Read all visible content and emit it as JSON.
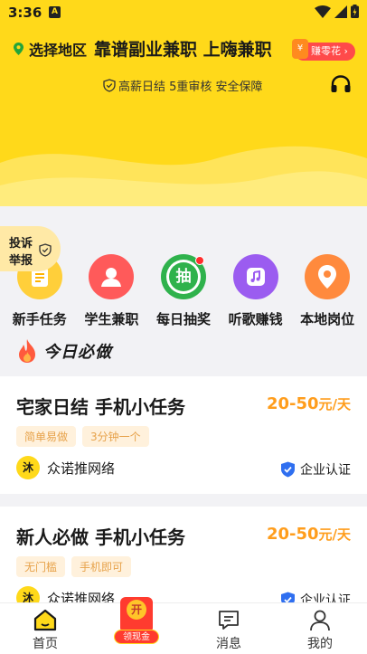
{
  "status_bar": {
    "time": "3:36",
    "notif_letter": "A"
  },
  "header": {
    "region_label": "选择地区",
    "slogan": "靠谱副业兼职 上嗨兼职",
    "earn_badge": "赚零花",
    "guarantee": "高薪日结 5重审核 安全保障"
  },
  "complaint": {
    "line1": "投诉",
    "line2": "举报"
  },
  "categories": [
    {
      "label": "新手任务",
      "color": "#ffcf3a",
      "icon": "checklist-icon"
    },
    {
      "label": "学生兼职",
      "color": "#ff5a5a",
      "icon": "student-icon"
    },
    {
      "label": "每日抽奖",
      "color": "#2fb24c",
      "icon": "lottery-icon",
      "icon_text": "抽"
    },
    {
      "label": "听歌赚钱",
      "color": "#9b5cf0",
      "icon": "music-icon"
    },
    {
      "label": "本地岗位",
      "color": "#ff8a3d",
      "icon": "location-icon"
    }
  ],
  "section": {
    "title": "今日必做"
  },
  "jobs": [
    {
      "title": "宅家日结 手机小任务",
      "salary": "20-50",
      "unit": "元/天",
      "tags": [
        "简单易做",
        "3分钟一个"
      ],
      "company_logo": "沐",
      "company": "众诺推网络",
      "cert": "企业认证"
    },
    {
      "title": "新人必做 手机小任务",
      "salary": "20-50",
      "unit": "元/天",
      "tags": [
        "无门槛",
        "手机即可"
      ],
      "company_logo": "沐",
      "company": "众诺推网络",
      "cert": "企业认证"
    }
  ],
  "bottom_nav": {
    "home": "首页",
    "redpack_coin": "开",
    "redpack_label": "领现金",
    "messages": "消息",
    "me": "我的"
  },
  "colors": {
    "brand_yellow": "#ffd91a",
    "salary_orange": "#ff9d1c",
    "cert_blue": "#2f6ff0"
  }
}
